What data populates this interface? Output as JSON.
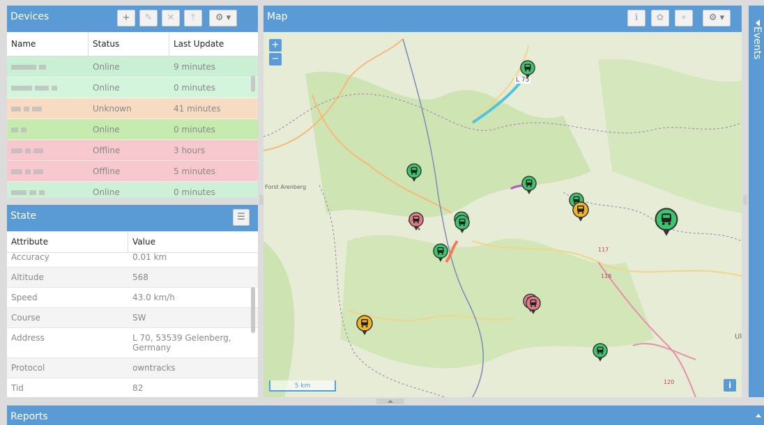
{
  "devices": {
    "title": "Devices",
    "toolbar": {
      "add": "+",
      "edit": "✎",
      "remove": "✕",
      "upload": "⤒",
      "settings": "⚙ ▾"
    },
    "columns": [
      "Name",
      "Status",
      "Last Update"
    ],
    "rows": [
      {
        "status": "Online",
        "last_update": "9 minutes",
        "color": "#c9f0d4"
      },
      {
        "status": "Online",
        "last_update": "0 minutes",
        "color": "#d3f5dc"
      },
      {
        "status": "Unknown",
        "last_update": "41 minutes",
        "color": "#f7dcc3"
      },
      {
        "status": "Online",
        "last_update": "0 minutes",
        "color": "#c5ebaf"
      },
      {
        "status": "Offline",
        "last_update": "3 hours",
        "color": "#f8c8cf"
      },
      {
        "status": "Offline",
        "last_update": "5 minutes",
        "color": "#f8c8cf"
      },
      {
        "status": "Online",
        "last_update": "0 minutes",
        "color": "#cdf0d7"
      }
    ]
  },
  "state": {
    "title": "State",
    "columns": [
      "Attribute",
      "Value"
    ],
    "rows": [
      {
        "attribute": "Accuracy",
        "value": "0.01 km"
      },
      {
        "attribute": "Altitude",
        "value": "568"
      },
      {
        "attribute": "Speed",
        "value": "43.0 km/h"
      },
      {
        "attribute": "Course",
        "value": "SW"
      },
      {
        "attribute": "Address",
        "value": "L 70, 53539 Gelenberg, Germany"
      },
      {
        "attribute": "Protocol",
        "value": "owntracks"
      },
      {
        "attribute": "Tid",
        "value": "82"
      }
    ]
  },
  "map": {
    "title": "Map",
    "zoom_in": "+",
    "zoom_out": "−",
    "scale_label": "5 km",
    "info": "i",
    "labels": {
      "forest": "Forst Arenberg",
      "road_117": "117",
      "road_118": "118",
      "road_120": "120",
      "town_l": "L 75",
      "ul": "Ul"
    },
    "colors": {
      "online": "#3ec46d",
      "offline": "#e07b88",
      "unknown": "#f0b429",
      "route_blue": "#4fc3e0",
      "route_red": "#f07a5a"
    }
  },
  "events": {
    "title": "Events"
  },
  "reports": {
    "title": "Reports"
  }
}
